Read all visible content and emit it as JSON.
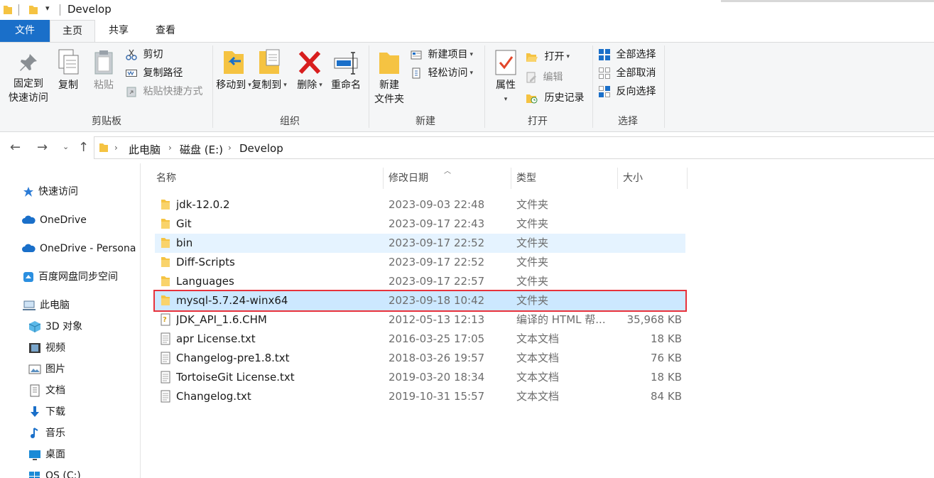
{
  "window": {
    "title": "Develop"
  },
  "colors": {
    "accent": "#1a6fc9",
    "selection": "#cce8ff",
    "hover": "#e5f3ff",
    "highlight_border": "#e8323b",
    "folder": "#f5c342"
  },
  "tabs": {
    "file": "文件",
    "home": "主页",
    "share": "共享",
    "view": "查看"
  },
  "ribbon": {
    "clipboard": {
      "label": "剪贴板",
      "pin_line1": "固定到",
      "pin_line2": "快速访问",
      "copy": "复制",
      "paste": "粘贴",
      "cut": "剪切",
      "copy_path": "复制路径",
      "paste_shortcut": "粘贴快捷方式"
    },
    "organize": {
      "label": "组织",
      "move_to": "移动到",
      "copy_to": "复制到",
      "delete": "删除",
      "rename": "重命名"
    },
    "new": {
      "label": "新建",
      "new_folder_line1": "新建",
      "new_folder_line2": "文件夹",
      "new_item": "新建项目",
      "easy_access": "轻松访问"
    },
    "open": {
      "label": "打开",
      "properties": "属性",
      "open": "打开",
      "edit": "编辑",
      "history": "历史记录"
    },
    "select": {
      "label": "选择",
      "select_all": "全部选择",
      "select_none": "全部取消",
      "invert": "反向选择"
    }
  },
  "address": {
    "crumbs": [
      "此电脑",
      "磁盘 (E:)",
      "Develop"
    ]
  },
  "nav": {
    "quick_access": "快速访问",
    "onedrive": "OneDrive",
    "onedrive_personal": "OneDrive - Persona",
    "baidu": "百度网盘同步空间",
    "this_pc": "此电脑",
    "objects3d": "3D 对象",
    "videos": "视频",
    "pictures": "图片",
    "documents": "文档",
    "downloads": "下载",
    "music": "音乐",
    "desktop": "桌面",
    "os": "OS (C:)"
  },
  "columns": {
    "name": "名称",
    "date": "修改日期",
    "type": "类型",
    "size": "大小"
  },
  "files": [
    {
      "name": "jdk-12.0.2",
      "date": "2023-09-03 22:48",
      "type": "文件夹",
      "size": "",
      "icon": "folder-icon"
    },
    {
      "name": "Git",
      "date": "2023-09-17 22:43",
      "type": "文件夹",
      "size": "",
      "icon": "folder-icon"
    },
    {
      "name": "bin",
      "date": "2023-09-17 22:52",
      "type": "文件夹",
      "size": "",
      "icon": "folder-icon"
    },
    {
      "name": "Diff-Scripts",
      "date": "2023-09-17 22:52",
      "type": "文件夹",
      "size": "",
      "icon": "folder-icon"
    },
    {
      "name": "Languages",
      "date": "2023-09-17 22:57",
      "type": "文件夹",
      "size": "",
      "icon": "folder-icon"
    },
    {
      "name": "mysql-5.7.24-winx64",
      "date": "2023-09-18 10:42",
      "type": "文件夹",
      "size": "",
      "icon": "folder-icon"
    },
    {
      "name": "JDK_API_1.6.CHM",
      "date": "2012-05-13 12:13",
      "type": "编译的 HTML 帮...",
      "size": "35,968 KB",
      "icon": "chm-help-icon"
    },
    {
      "name": "apr License.txt",
      "date": "2016-03-25 17:05",
      "type": "文本文档",
      "size": "18 KB",
      "icon": "text-file-icon"
    },
    {
      "name": "Changelog-pre1.8.txt",
      "date": "2018-03-26 19:57",
      "type": "文本文档",
      "size": "76 KB",
      "icon": "text-file-icon"
    },
    {
      "name": "TortoiseGit License.txt",
      "date": "2019-03-20 18:34",
      "type": "文本文档",
      "size": "18 KB",
      "icon": "text-file-icon"
    },
    {
      "name": "Changelog.txt",
      "date": "2019-10-31 15:57",
      "type": "文本文档",
      "size": "84 KB",
      "icon": "text-file-icon"
    }
  ]
}
